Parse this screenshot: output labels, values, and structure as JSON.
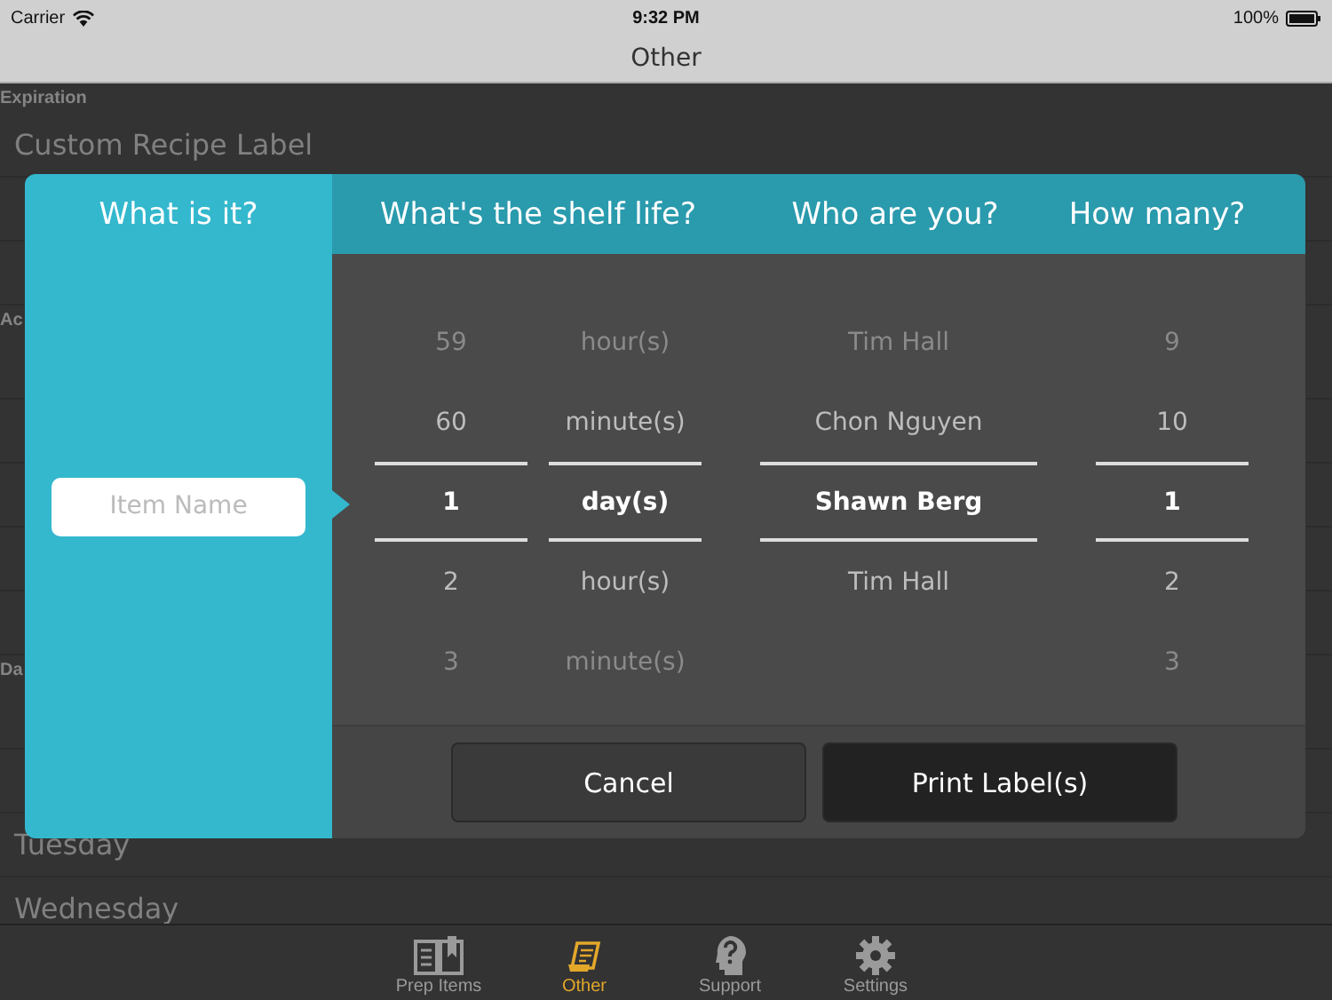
{
  "status_bar": {
    "carrier": "Carrier",
    "time": "9:32 PM",
    "battery": "100%"
  },
  "nav_bar": {
    "title": "Other"
  },
  "list": [
    {
      "kind": "header",
      "text": "Expiration"
    },
    {
      "kind": "row",
      "text": "Custom Recipe Label"
    },
    {
      "kind": "row"
    },
    {
      "kind": "row"
    },
    {
      "kind": "header",
      "text": "Ac"
    },
    {
      "kind": "row"
    },
    {
      "kind": "row"
    },
    {
      "kind": "row"
    },
    {
      "kind": "row"
    },
    {
      "kind": "row"
    },
    {
      "kind": "header",
      "text": "Da"
    },
    {
      "kind": "row"
    },
    {
      "kind": "row"
    },
    {
      "kind": "row",
      "text": "Tuesday"
    },
    {
      "kind": "row",
      "text": "Wednesday"
    }
  ],
  "dialog": {
    "left_title": "What is it?",
    "item_field": {
      "placeholder": "Item Name"
    },
    "headers": [
      "What's the shelf life?",
      "Who are you?",
      "How many?"
    ],
    "pickers": [
      {
        "items": [
          {
            "text": "59",
            "selected": false
          },
          {
            "text": "60",
            "selected": false
          },
          {
            "text": "1",
            "selected": true
          },
          {
            "text": "2",
            "selected": false
          },
          {
            "text": "3",
            "selected": false
          }
        ]
      },
      {
        "items": [
          {
            "text": "hour(s)",
            "selected": false
          },
          {
            "text": "minute(s)",
            "selected": false
          },
          {
            "text": "day(s)",
            "selected": true
          },
          {
            "text": "hour(s)",
            "selected": false
          },
          {
            "text": "minute(s)",
            "selected": false
          }
        ]
      },
      {
        "items": [
          {
            "text": "Tim Hall",
            "selected": false
          },
          {
            "text": "Chon Nguyen",
            "selected": false
          },
          {
            "text": "Shawn Berg",
            "selected": true
          },
          {
            "text": "Tim Hall",
            "selected": false
          }
        ]
      },
      {
        "items": [
          {
            "text": "9",
            "selected": false
          },
          {
            "text": "10",
            "selected": false
          },
          {
            "text": "1",
            "selected": true
          },
          {
            "text": "2",
            "selected": false
          },
          {
            "text": "3",
            "selected": false
          }
        ]
      }
    ],
    "buttons": [
      {
        "label": "Cancel",
        "kind": "secondary"
      },
      {
        "label": "Print Label(s)",
        "kind": "primary"
      }
    ]
  },
  "tab_bar": [
    {
      "label": "Prep Items",
      "selected": false
    },
    {
      "label": "Other",
      "selected": true
    },
    {
      "label": "Support",
      "selected": false
    },
    {
      "label": "Settings",
      "selected": false
    }
  ]
}
